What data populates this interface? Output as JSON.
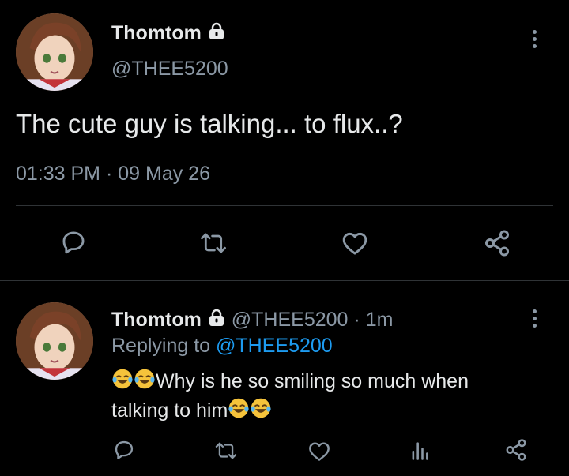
{
  "main_tweet": {
    "display_name": "Thomtom",
    "handle": "@THEE5200",
    "text": "The cute guy is talking... to flux..?",
    "time": "01:33 PM",
    "separator": "·",
    "date": "09 May 26"
  },
  "reply": {
    "display_name": "Thomtom",
    "handle": "@THEE5200",
    "separator": "·",
    "age": "1m",
    "replying_prefix": "Replying to",
    "replying_handle": "@THEE5200",
    "text_line1": "Why is he so smiling so much when",
    "text_line2": "talking to him"
  },
  "icons": {
    "more": "more-vertical-icon",
    "lock": "lock-icon",
    "reply": "reply-bubble-icon",
    "retweet": "retweet-icon",
    "like": "heart-icon",
    "share": "share-icon",
    "analytics": "analytics-bars-icon",
    "emoji": "face-with-tears-of-joy-emoji"
  },
  "colors": {
    "background": "#000000",
    "text": "#e7e9ea",
    "secondary": "#8b98a5",
    "link": "#1d9bf0",
    "divider": "#2f3336"
  }
}
